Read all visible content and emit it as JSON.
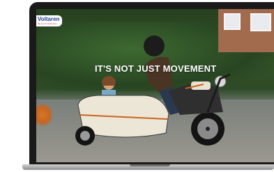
{
  "brand": {
    "name": "Voltaren",
    "tagline": "the joy of movement"
  },
  "hero": {
    "headline": "IT'S NOT JUST MOVEMENT"
  },
  "colors": {
    "brand_blue": "#1d3f8f",
    "brand_red": "#c8102e",
    "frame": "#1a1a1a"
  }
}
